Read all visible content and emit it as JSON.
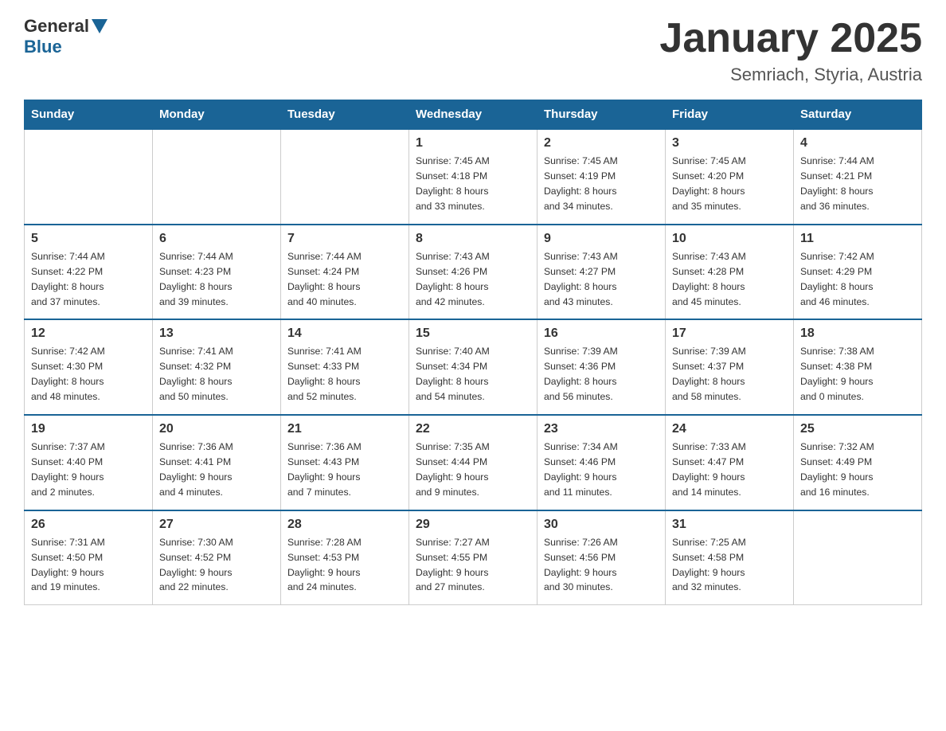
{
  "header": {
    "logo_general": "General",
    "logo_blue": "Blue",
    "title": "January 2025",
    "subtitle": "Semriach, Styria, Austria"
  },
  "weekdays": [
    "Sunday",
    "Monday",
    "Tuesday",
    "Wednesday",
    "Thursday",
    "Friday",
    "Saturday"
  ],
  "weeks": [
    [
      {
        "num": "",
        "info": ""
      },
      {
        "num": "",
        "info": ""
      },
      {
        "num": "",
        "info": ""
      },
      {
        "num": "1",
        "info": "Sunrise: 7:45 AM\nSunset: 4:18 PM\nDaylight: 8 hours\nand 33 minutes."
      },
      {
        "num": "2",
        "info": "Sunrise: 7:45 AM\nSunset: 4:19 PM\nDaylight: 8 hours\nand 34 minutes."
      },
      {
        "num": "3",
        "info": "Sunrise: 7:45 AM\nSunset: 4:20 PM\nDaylight: 8 hours\nand 35 minutes."
      },
      {
        "num": "4",
        "info": "Sunrise: 7:44 AM\nSunset: 4:21 PM\nDaylight: 8 hours\nand 36 minutes."
      }
    ],
    [
      {
        "num": "5",
        "info": "Sunrise: 7:44 AM\nSunset: 4:22 PM\nDaylight: 8 hours\nand 37 minutes."
      },
      {
        "num": "6",
        "info": "Sunrise: 7:44 AM\nSunset: 4:23 PM\nDaylight: 8 hours\nand 39 minutes."
      },
      {
        "num": "7",
        "info": "Sunrise: 7:44 AM\nSunset: 4:24 PM\nDaylight: 8 hours\nand 40 minutes."
      },
      {
        "num": "8",
        "info": "Sunrise: 7:43 AM\nSunset: 4:26 PM\nDaylight: 8 hours\nand 42 minutes."
      },
      {
        "num": "9",
        "info": "Sunrise: 7:43 AM\nSunset: 4:27 PM\nDaylight: 8 hours\nand 43 minutes."
      },
      {
        "num": "10",
        "info": "Sunrise: 7:43 AM\nSunset: 4:28 PM\nDaylight: 8 hours\nand 45 minutes."
      },
      {
        "num": "11",
        "info": "Sunrise: 7:42 AM\nSunset: 4:29 PM\nDaylight: 8 hours\nand 46 minutes."
      }
    ],
    [
      {
        "num": "12",
        "info": "Sunrise: 7:42 AM\nSunset: 4:30 PM\nDaylight: 8 hours\nand 48 minutes."
      },
      {
        "num": "13",
        "info": "Sunrise: 7:41 AM\nSunset: 4:32 PM\nDaylight: 8 hours\nand 50 minutes."
      },
      {
        "num": "14",
        "info": "Sunrise: 7:41 AM\nSunset: 4:33 PM\nDaylight: 8 hours\nand 52 minutes."
      },
      {
        "num": "15",
        "info": "Sunrise: 7:40 AM\nSunset: 4:34 PM\nDaylight: 8 hours\nand 54 minutes."
      },
      {
        "num": "16",
        "info": "Sunrise: 7:39 AM\nSunset: 4:36 PM\nDaylight: 8 hours\nand 56 minutes."
      },
      {
        "num": "17",
        "info": "Sunrise: 7:39 AM\nSunset: 4:37 PM\nDaylight: 8 hours\nand 58 minutes."
      },
      {
        "num": "18",
        "info": "Sunrise: 7:38 AM\nSunset: 4:38 PM\nDaylight: 9 hours\nand 0 minutes."
      }
    ],
    [
      {
        "num": "19",
        "info": "Sunrise: 7:37 AM\nSunset: 4:40 PM\nDaylight: 9 hours\nand 2 minutes."
      },
      {
        "num": "20",
        "info": "Sunrise: 7:36 AM\nSunset: 4:41 PM\nDaylight: 9 hours\nand 4 minutes."
      },
      {
        "num": "21",
        "info": "Sunrise: 7:36 AM\nSunset: 4:43 PM\nDaylight: 9 hours\nand 7 minutes."
      },
      {
        "num": "22",
        "info": "Sunrise: 7:35 AM\nSunset: 4:44 PM\nDaylight: 9 hours\nand 9 minutes."
      },
      {
        "num": "23",
        "info": "Sunrise: 7:34 AM\nSunset: 4:46 PM\nDaylight: 9 hours\nand 11 minutes."
      },
      {
        "num": "24",
        "info": "Sunrise: 7:33 AM\nSunset: 4:47 PM\nDaylight: 9 hours\nand 14 minutes."
      },
      {
        "num": "25",
        "info": "Sunrise: 7:32 AM\nSunset: 4:49 PM\nDaylight: 9 hours\nand 16 minutes."
      }
    ],
    [
      {
        "num": "26",
        "info": "Sunrise: 7:31 AM\nSunset: 4:50 PM\nDaylight: 9 hours\nand 19 minutes."
      },
      {
        "num": "27",
        "info": "Sunrise: 7:30 AM\nSunset: 4:52 PM\nDaylight: 9 hours\nand 22 minutes."
      },
      {
        "num": "28",
        "info": "Sunrise: 7:28 AM\nSunset: 4:53 PM\nDaylight: 9 hours\nand 24 minutes."
      },
      {
        "num": "29",
        "info": "Sunrise: 7:27 AM\nSunset: 4:55 PM\nDaylight: 9 hours\nand 27 minutes."
      },
      {
        "num": "30",
        "info": "Sunrise: 7:26 AM\nSunset: 4:56 PM\nDaylight: 9 hours\nand 30 minutes."
      },
      {
        "num": "31",
        "info": "Sunrise: 7:25 AM\nSunset: 4:58 PM\nDaylight: 9 hours\nand 32 minutes."
      },
      {
        "num": "",
        "info": ""
      }
    ]
  ]
}
